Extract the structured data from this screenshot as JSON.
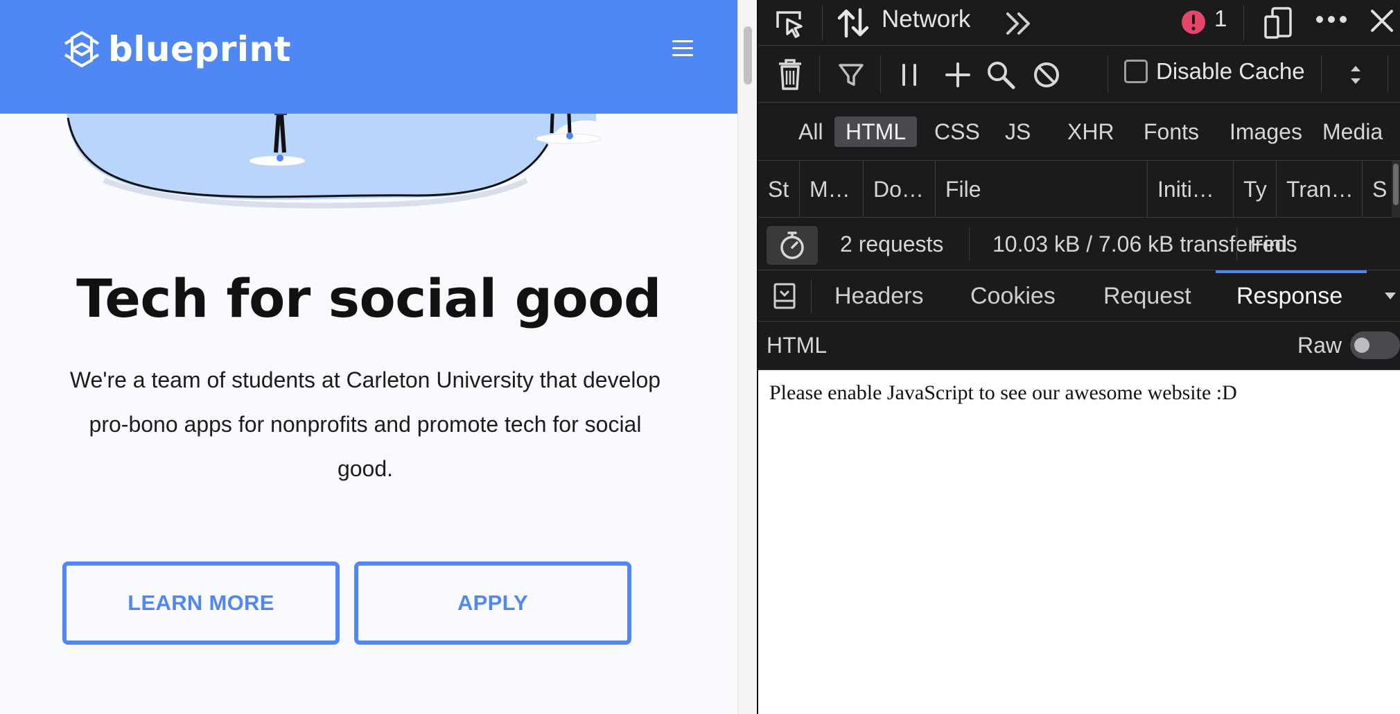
{
  "site": {
    "brand": "blueprint",
    "hero_title": "Tech for social good",
    "hero_text": "We're a team of students at Carleton University that develop pro-bono apps for nonprofits and promote tech for social good.",
    "learn_more": "LEARN MORE",
    "apply": "APPLY",
    "colors": {
      "brand_blue": "#4f87f5",
      "page_bg": "#f9fafd"
    }
  },
  "devtools": {
    "toolbar": {
      "title": "Network",
      "error_count": "1",
      "icons": [
        "element-picker-icon",
        "network-arrows-icon",
        "chevron-double-right-icon",
        "error-icon",
        "responsive-design-icon",
        "more-icon",
        "close-icon"
      ]
    },
    "actions": {
      "disable_cache": "Disable Cache",
      "icons": [
        "trash-icon",
        "filter-icon",
        "pause-icon",
        "plus-icon",
        "search-icon",
        "block-icon",
        "throttle-icon"
      ]
    },
    "type_filters": [
      {
        "label": "All",
        "active": false
      },
      {
        "label": "HTML",
        "active": true
      },
      {
        "label": "CSS",
        "active": false
      },
      {
        "label": "JS",
        "active": false
      },
      {
        "label": "XHR",
        "active": false
      },
      {
        "label": "Fonts",
        "active": false
      },
      {
        "label": "Images",
        "active": false
      },
      {
        "label": "Media",
        "active": false
      }
    ],
    "columns": [
      "St",
      "M…",
      "Do…",
      "File",
      "Initi…",
      "Ty",
      "Tran…",
      "S"
    ],
    "summary": {
      "requests": "2 requests",
      "transferred": "10.03 kB / 7.06 kB transferred",
      "finish": "Finis"
    },
    "tabs": [
      "Headers",
      "Cookies",
      "Request",
      "Response"
    ],
    "selected_tab": "Response",
    "subhead": {
      "label": "HTML",
      "raw": "Raw"
    },
    "response_text": "Please enable JavaScript to see our awesome website :D",
    "colors": {
      "panel_bg": "#1b1b1d",
      "selected_tab_underline": "#4f87f5",
      "error_red": "#e8456a"
    }
  }
}
